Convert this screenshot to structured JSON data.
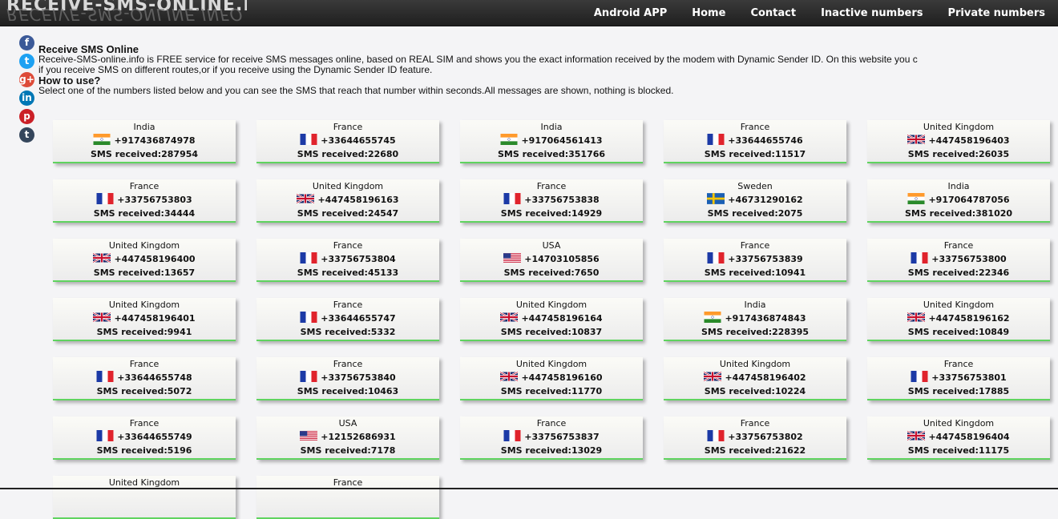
{
  "site": {
    "logo_text": "RECEIVE-SMS-ONLINE.INFO",
    "logo_reflection": "RECEIVE-SMS-ONLINE.INFO"
  },
  "nav": {
    "items": [
      "Android APP",
      "Home",
      "Contact",
      "Inactive numbers",
      "Private numbers"
    ]
  },
  "social_icons": [
    {
      "name": "facebook-icon",
      "glyph": "f",
      "color": "#3b5998"
    },
    {
      "name": "twitter-icon",
      "glyph": "t",
      "color": "#1da1f2"
    },
    {
      "name": "google-plus-icon",
      "glyph": "g+",
      "color": "#dd4b39"
    },
    {
      "name": "linkedin-icon",
      "glyph": "in",
      "color": "#0077b5"
    },
    {
      "name": "pinterest-icon",
      "glyph": "p",
      "color": "#cb2027"
    },
    {
      "name": "tumblr-icon",
      "glyph": "t",
      "color": "#35465c"
    }
  ],
  "intro": {
    "title": "Receive SMS Online",
    "description_line1": "Receive-SMS-online.info is FREE service for receive SMS messages online, based on REAL SIM and shows you the exact information received by the modem with Dynamic Sender ID. On this website you c",
    "description_line2": "if you receive SMS on different routes,or if you receive using the Dynamic Sender ID feature.",
    "how_title": "How to use?",
    "how_text": "Select one of the numbers listed below and you can see the SMS that reach that number within seconds.All messages are shown, nothing is blocked."
  },
  "numbers": [
    {
      "country": "India",
      "flag": "in",
      "number": "+917436874978",
      "sms": "SMS received:287954"
    },
    {
      "country": "France",
      "flag": "fr",
      "number": "+33644655745",
      "sms": "SMS received:22680"
    },
    {
      "country": "India",
      "flag": "in",
      "number": "+917064561413",
      "sms": "SMS received:351766"
    },
    {
      "country": "France",
      "flag": "fr",
      "number": "+33644655746",
      "sms": "SMS received:11517"
    },
    {
      "country": "United Kingdom",
      "flag": "uk",
      "number": "+447458196403",
      "sms": "SMS received:26035"
    },
    {
      "country": "France",
      "flag": "fr",
      "number": "+33756753803",
      "sms": "SMS received:34444"
    },
    {
      "country": "United Kingdom",
      "flag": "uk",
      "number": "+447458196163",
      "sms": "SMS received:24547"
    },
    {
      "country": "France",
      "flag": "fr",
      "number": "+33756753838",
      "sms": "SMS received:14929"
    },
    {
      "country": "Sweden",
      "flag": "se",
      "number": "+46731290162",
      "sms": "SMS received:2075"
    },
    {
      "country": "India",
      "flag": "in",
      "number": "+917064787056",
      "sms": "SMS received:381020"
    },
    {
      "country": "United Kingdom",
      "flag": "uk",
      "number": "+447458196400",
      "sms": "SMS received:13657"
    },
    {
      "country": "France",
      "flag": "fr",
      "number": "+33756753804",
      "sms": "SMS received:45133"
    },
    {
      "country": "USA",
      "flag": "us",
      "number": "+14703105856",
      "sms": "SMS received:7650"
    },
    {
      "country": "France",
      "flag": "fr",
      "number": "+33756753839",
      "sms": "SMS received:10941"
    },
    {
      "country": "France",
      "flag": "fr",
      "number": "+33756753800",
      "sms": "SMS received:22346"
    },
    {
      "country": "United Kingdom",
      "flag": "uk",
      "number": "+447458196401",
      "sms": "SMS received:9941"
    },
    {
      "country": "France",
      "flag": "fr",
      "number": "+33644655747",
      "sms": "SMS received:5332"
    },
    {
      "country": "United Kingdom",
      "flag": "uk",
      "number": "+447458196164",
      "sms": "SMS received:10837"
    },
    {
      "country": "India",
      "flag": "in",
      "number": "+917436874843",
      "sms": "SMS received:228395"
    },
    {
      "country": "United Kingdom",
      "flag": "uk",
      "number": "+447458196162",
      "sms": "SMS received:10849"
    },
    {
      "country": "France",
      "flag": "fr",
      "number": "+33644655748",
      "sms": "SMS received:5072"
    },
    {
      "country": "France",
      "flag": "fr",
      "number": "+33756753840",
      "sms": "SMS received:10463"
    },
    {
      "country": "United Kingdom",
      "flag": "uk",
      "number": "+447458196160",
      "sms": "SMS received:11770"
    },
    {
      "country": "United Kingdom",
      "flag": "uk",
      "number": "+447458196402",
      "sms": "SMS received:10224"
    },
    {
      "country": "France",
      "flag": "fr",
      "number": "+33756753801",
      "sms": "SMS received:17885"
    },
    {
      "country": "France",
      "flag": "fr",
      "number": "+33644655749",
      "sms": "SMS received:5196"
    },
    {
      "country": "USA",
      "flag": "us",
      "number": "+12152686931",
      "sms": "SMS received:7178"
    },
    {
      "country": "France",
      "flag": "fr",
      "number": "+33756753837",
      "sms": "SMS received:13029"
    },
    {
      "country": "France",
      "flag": "fr",
      "number": "+33756753802",
      "sms": "SMS received:21622"
    },
    {
      "country": "United Kingdom",
      "flag": "uk",
      "number": "+447458196404",
      "sms": "SMS received:11175"
    },
    {
      "country": "United Kingdom",
      "flag": "uk",
      "number": "",
      "sms": ""
    },
    {
      "country": "France",
      "flag": "fr",
      "number": "",
      "sms": ""
    }
  ],
  "colors": {
    "card_border": "#5fd35f",
    "topbar": "#2b2b2b",
    "page_bg": "#f4f4f6"
  }
}
